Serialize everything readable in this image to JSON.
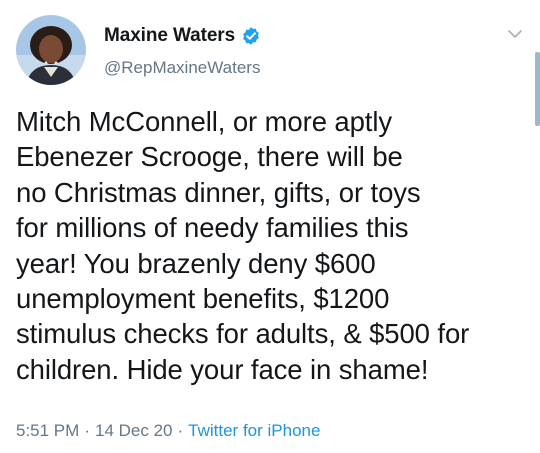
{
  "author": {
    "display_name": "Maxine Waters",
    "handle": "@RepMaxineWaters",
    "verified": true,
    "verified_color": "#1da1f2"
  },
  "tweet": {
    "text": "Mitch McConnell, or more aptly\nEbenezer Scrooge, there will be\nno Christmas dinner, gifts, or toys\nfor millions of needy families this\nyear! You brazenly deny $600\nunemployment benefits, $1200\nstimulus checks for adults, & $500 for\nchildren. Hide your face in shame!",
    "time": "5:51 PM",
    "separator": "·",
    "date": "14 Dec 20",
    "source": "Twitter for iPhone"
  },
  "icons": {
    "menu": "chevron-down-icon",
    "verified": "verified-badge-icon"
  },
  "colors": {
    "text_primary": "#14171a",
    "text_secondary": "#657786",
    "link": "#1b95e0"
  }
}
